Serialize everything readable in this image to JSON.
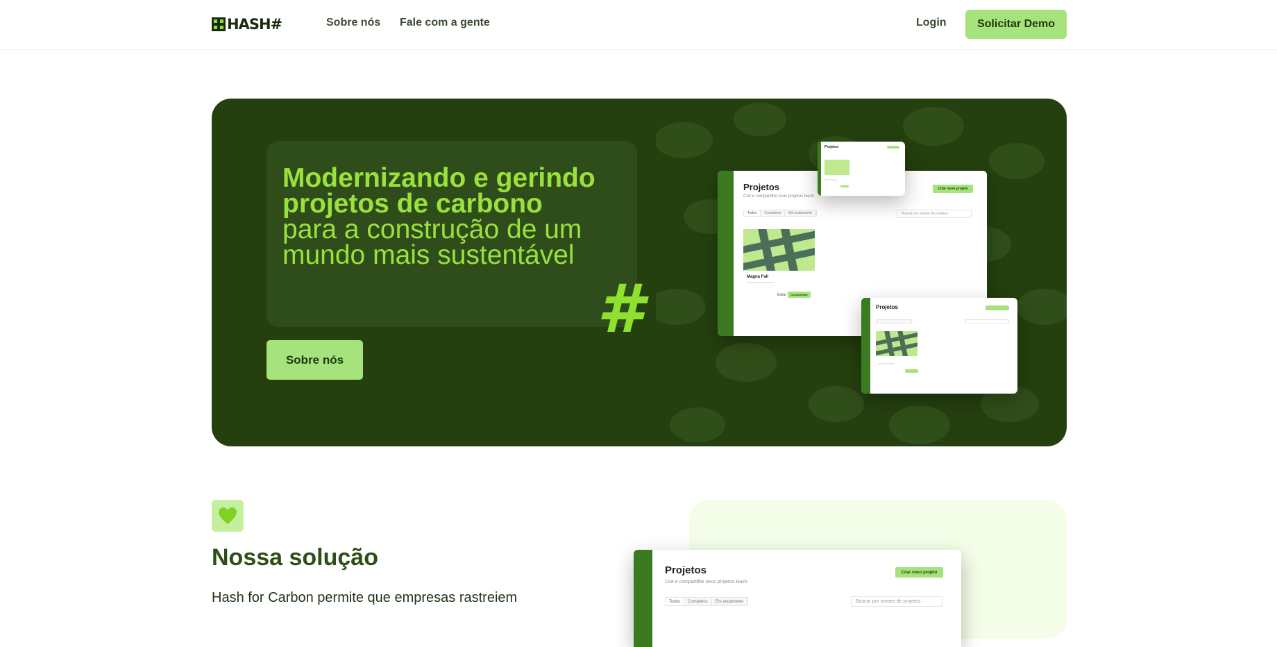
{
  "nav": {
    "logo_text": "HASH#",
    "links": [
      "Sobre nós",
      "Fale com a gente"
    ],
    "login": "Login",
    "demo_button": "Solicitar Demo"
  },
  "hero": {
    "title_bold": "Modernizando e gerindo projetos de carbono",
    "title_light": "para a construção de um mundo mais sustentável",
    "hash_glyph": "#",
    "button": "Sobre nós"
  },
  "mock_app": {
    "title": "Projetos",
    "subtitle": "Crie e compartilhe seus projetos Hash",
    "create_button": "Criar novo projeto",
    "tabs": [
      "Todos",
      "Completos",
      "Em andamento"
    ],
    "search_placeholder": "Buscar por nomes de projetos",
    "card_name": "Magna Fall",
    "card_edit": "Editar",
    "card_share": "Compartilhar"
  },
  "solution": {
    "icon": "heart-icon",
    "title": "Nossa solução",
    "text": "Hash for Carbon permite que empresas rastreiem"
  },
  "colors": {
    "hero_bg": "#25400f",
    "accent": "#a7e37d",
    "title_green": "#9be13c"
  }
}
